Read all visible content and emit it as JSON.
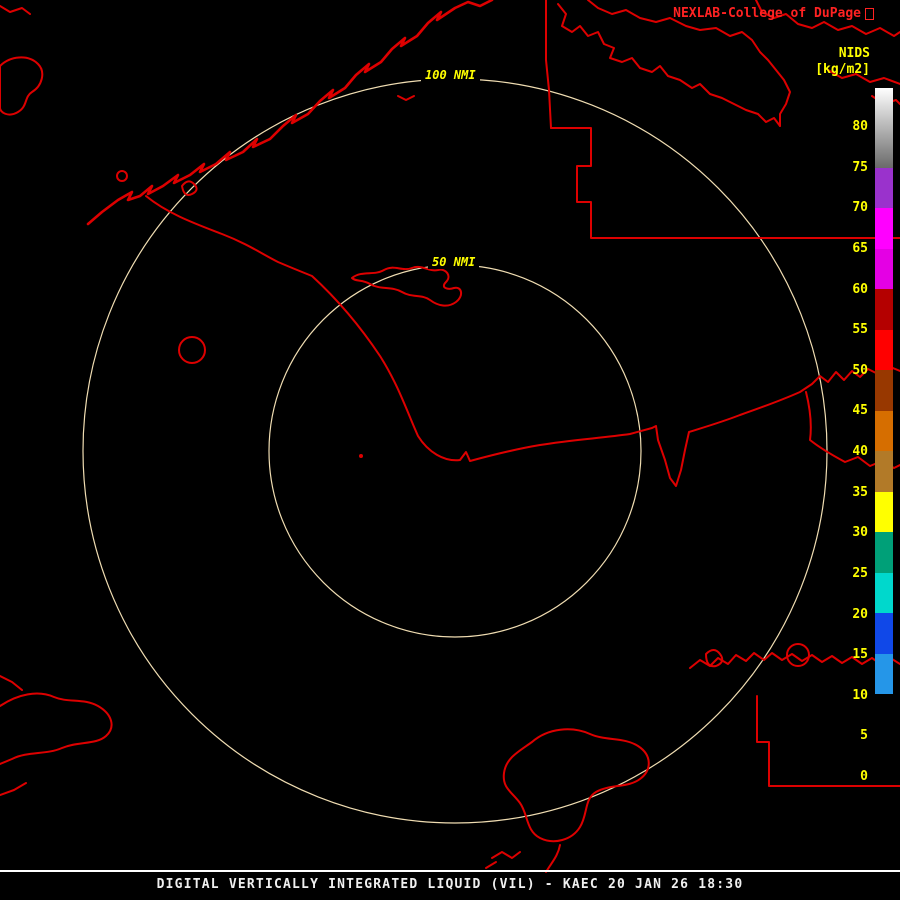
{
  "header": {
    "credit": "NEXLAB-College of DuPage",
    "scale_title": "NIDS",
    "scale_units": "[kg/m2]"
  },
  "rings": {
    "outer_label": "100 NMI",
    "inner_label": "50 NMI"
  },
  "colorbar": {
    "tick_labels": [
      "80",
      "75",
      "70",
      "65",
      "60",
      "55",
      "50",
      "45",
      "40",
      "35",
      "30",
      "25",
      "20",
      "15",
      "10",
      "5",
      "0"
    ],
    "segments": [
      {
        "range": "75-80plus",
        "color": "#ffffff",
        "color2": "#6a6a6a",
        "height": 80
      },
      {
        "range": "70-75",
        "color": "#9a32cc",
        "height": 40
      },
      {
        "range": "65-70",
        "color": "#ff00ff",
        "height": 41
      },
      {
        "range": "60-65",
        "color": "#e400e4",
        "height": 40
      },
      {
        "range": "55-60",
        "color": "#b40000",
        "height": 41
      },
      {
        "range": "50-55",
        "color": "#ff0000",
        "height": 40
      },
      {
        "range": "45-50",
        "color": "#983800",
        "height": 41
      },
      {
        "range": "40-45",
        "color": "#d66e00",
        "height": 40
      },
      {
        "range": "35-40",
        "color": "#b27a28",
        "height": 41
      },
      {
        "range": "30-35",
        "color": "#ffff00",
        "height": 40
      },
      {
        "range": "25-30",
        "color": "#00a078",
        "height": 41
      },
      {
        "range": "20-25",
        "color": "#00d8cc",
        "height": 40
      },
      {
        "range": "15-20",
        "color": "#1048e8",
        "height": 41
      },
      {
        "range": "10-15",
        "color": "#2596e8",
        "height": 40
      },
      {
        "range": "5-10",
        "color": "#000000",
        "height": 41
      },
      {
        "range": "0-5",
        "color": "#000000",
        "height": 48
      }
    ]
  },
  "footer": {
    "product_line": "DIGITAL VERTICALLY INTEGRATED LIQUID (VIL) - KAEC 20 JAN 26 18:30"
  },
  "colors": {
    "background": "#000000",
    "map_outline": "#dd0000",
    "range_ring": "#f0ddb2",
    "tick_text": "#ffff00",
    "credit_text": "#ff2222",
    "footer_text": "#f0f0f0",
    "separator": "#ffffff"
  }
}
